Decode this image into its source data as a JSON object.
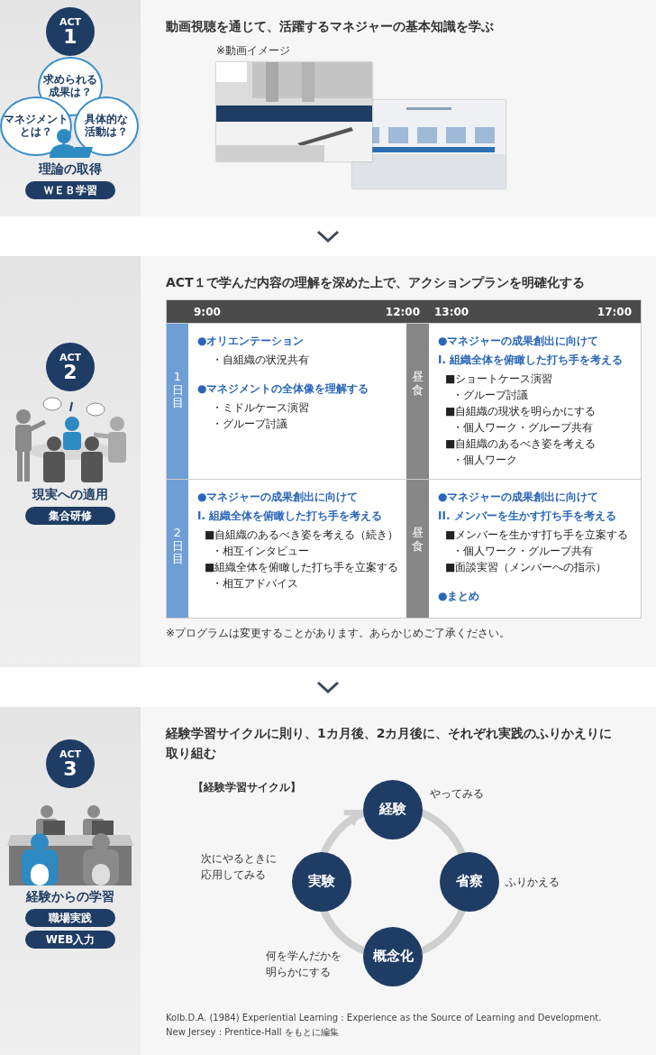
{
  "sections": [
    {
      "kind": "video",
      "act": {
        "label": "ACT",
        "number": "1"
      },
      "bubbles": [
        "求められる成果は？",
        "マネジメントとは？",
        "具体的な活動は？"
      ],
      "title": "理論の取得",
      "tags": [
        "ＷＥＢ学習"
      ],
      "heading": "動画視聴を通じて、活躍するマネジャーの基本知識を学ぶ",
      "caption": "※動画イメージ"
    },
    {
      "kind": "schedule",
      "act": {
        "label": "ACT",
        "number": "2"
      },
      "title": "現実への適用",
      "tags": [
        "集合研修"
      ],
      "heading": "ACT１で学んだ内容の理解を深めた上で、アクションプランを明確化する",
      "times": [
        "9:00",
        "12:00",
        "13:00",
        "17:00"
      ],
      "days": [
        {
          "label": "1日目",
          "lunch": "昼食",
          "morning": [
            {
              "kind": "topic",
              "text": "●オリエンテーション"
            },
            {
              "kind": "sub",
              "text": "・自組織の状況共有"
            },
            {
              "kind": "topic",
              "text": "●マネジメントの全体像を理解する"
            },
            {
              "kind": "sub",
              "text": "・ミドルケース演習"
            },
            {
              "kind": "sub",
              "text": "・グループ討議"
            }
          ],
          "afternoon": [
            {
              "kind": "topic",
              "text": "●マネジャーの成果創出に向けて"
            },
            {
              "kind": "heading",
              "text": "I. 組織全体を俯瞰した打ち手を考える"
            },
            {
              "kind": "task",
              "text": "■ショートケース演習"
            },
            {
              "kind": "sub",
              "text": "・グループ討議"
            },
            {
              "kind": "task",
              "text": "■自組織の現状を明らかにする"
            },
            {
              "kind": "sub",
              "text": "・個人ワーク・グループ共有"
            },
            {
              "kind": "task",
              "text": "■自組織のあるべき姿を考える"
            },
            {
              "kind": "sub",
              "text": "・個人ワーク"
            }
          ]
        },
        {
          "label": "2日目",
          "lunch": "昼食",
          "morning": [
            {
              "kind": "topic",
              "text": "●マネジャーの成果創出に向けて"
            },
            {
              "kind": "heading",
              "text": "I. 組織全体を俯瞰した打ち手を考える"
            },
            {
              "kind": "task",
              "text": "■自組織のあるべき姿を考える（続き）"
            },
            {
              "kind": "sub",
              "text": "・相互インタビュー"
            },
            {
              "kind": "task",
              "text": "■組織全体を俯瞰した打ち手を立案する"
            },
            {
              "kind": "sub",
              "text": "・相互アドバイス"
            }
          ],
          "afternoon": [
            {
              "kind": "topic",
              "text": "●マネジャーの成果創出に向けて"
            },
            {
              "kind": "heading",
              "text": "II. メンバーを生かす打ち手を考える"
            },
            {
              "kind": "task",
              "text": "■メンバーを生かす打ち手を立案する"
            },
            {
              "kind": "sub",
              "text": "・個人ワーク・グループ共有"
            },
            {
              "kind": "task",
              "text": "■面談実習（メンバーへの指示）"
            },
            {
              "kind": "topic",
              "text": "●まとめ"
            }
          ]
        }
      ],
      "note": "※プログラムは変更することがあります。あらかじめご了承ください。"
    },
    {
      "kind": "cycle",
      "act": {
        "label": "ACT",
        "number": "3"
      },
      "title": "経験からの学習",
      "tags": [
        "職場実践",
        "WEB入力"
      ],
      "heading": "経験学習サイクルに則り、1カ月後、2カ月後に、それぞれ実践のふりかえりに取り組む",
      "cycle_title": "【経験学習サイクル】",
      "stages": [
        {
          "label": "経験",
          "caption": "やってみる"
        },
        {
          "label": "省察",
          "caption": "ふりかえる"
        },
        {
          "label": "概念化",
          "caption": "何を学んだかを明らかにする"
        },
        {
          "label": "実験",
          "caption": "次にやるときに応用してみる"
        }
      ],
      "citation": [
        "Kolb.D.A. (1984) Experiential Learning : Experience as the Source of Learning and Development.",
        "New Jersey : Prentice-Hall をもとに編集"
      ]
    }
  ]
}
